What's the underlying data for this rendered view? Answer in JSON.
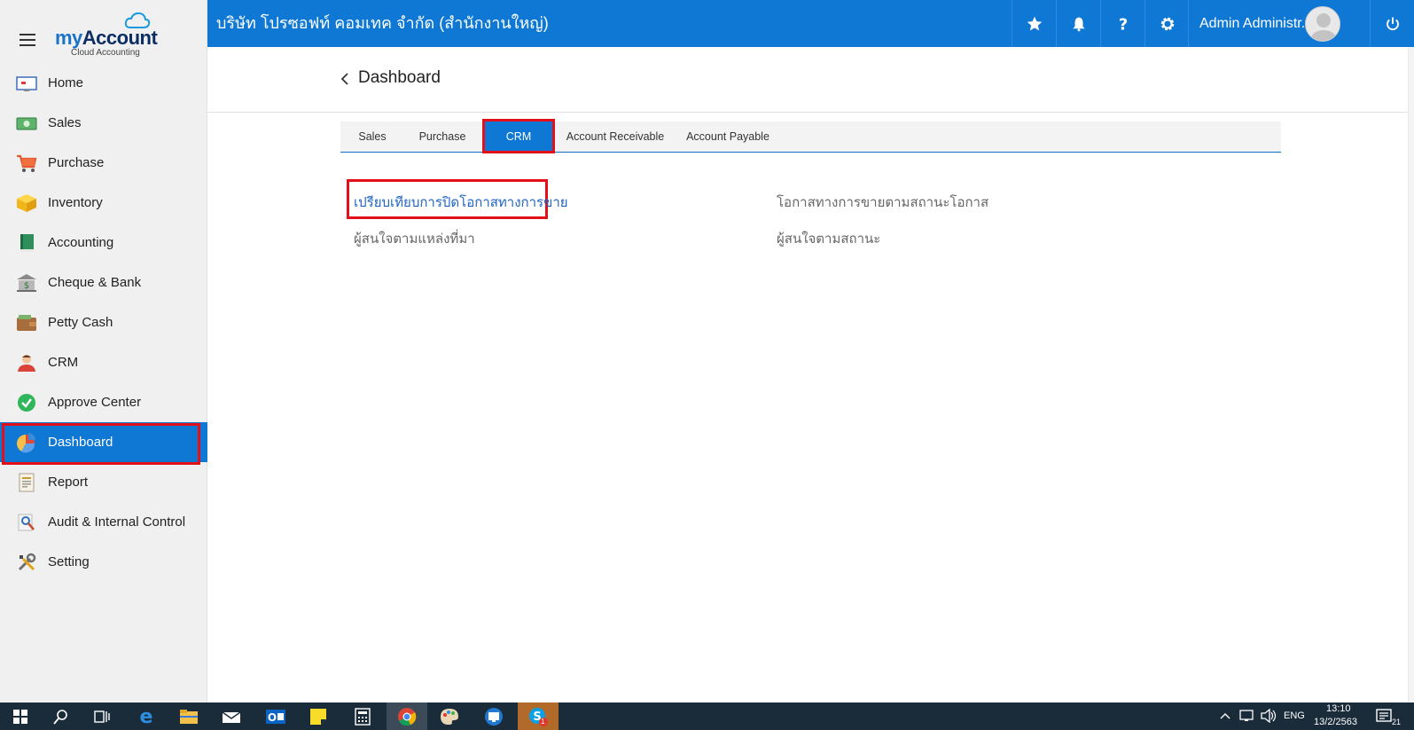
{
  "logo": {
    "brand_my": "my",
    "brand_account": "Account",
    "subtitle": "Cloud Accounting"
  },
  "sidebar": {
    "items": [
      {
        "label": "Home",
        "icon": "home-icon"
      },
      {
        "label": "Sales",
        "icon": "money-icon"
      },
      {
        "label": "Purchase",
        "icon": "cart-icon"
      },
      {
        "label": "Inventory",
        "icon": "box-icon"
      },
      {
        "label": "Accounting",
        "icon": "ledger-icon"
      },
      {
        "label": "Cheque & Bank",
        "icon": "bank-icon"
      },
      {
        "label": "Petty Cash",
        "icon": "wallet-icon"
      },
      {
        "label": "CRM",
        "icon": "people-icon"
      },
      {
        "label": "Approve Center",
        "icon": "check-circle-icon"
      },
      {
        "label": "Dashboard",
        "icon": "pie-chart-icon",
        "active": true
      },
      {
        "label": "Report",
        "icon": "report-icon"
      },
      {
        "label": "Audit & Internal Control",
        "icon": "magnifier-icon"
      },
      {
        "label": "Setting",
        "icon": "tools-icon"
      }
    ]
  },
  "topbar": {
    "company": "บริษัท โปรซอฟท์ คอมเทค จำกัด (สำนักงานใหญ่)",
    "user": "Admin Administr..."
  },
  "page": {
    "title": "Dashboard"
  },
  "tabs": [
    {
      "label": "Sales"
    },
    {
      "label": "Purchase"
    },
    {
      "label": "CRM",
      "active": true
    },
    {
      "label": "Account Receivable"
    },
    {
      "label": "Account Payable"
    }
  ],
  "links": {
    "left": [
      "เปรียบเทียบการปิดโอกาสทางการขาย",
      "ผู้สนใจตามแหล่งที่มา"
    ],
    "right": [
      "โอกาสทางการขายตามสถานะโอกาส",
      "ผู้สนใจตามสถานะ"
    ]
  },
  "taskbar": {
    "time": "13:10",
    "date": "13/2/2563",
    "lang": "ENG",
    "notif_count": "21",
    "skype_badge": "1"
  },
  "colors": {
    "primary": "#0f78d4",
    "highlight": "#e3101a",
    "sidebar_bg": "#f0f0f0",
    "link": "#1e63c4"
  }
}
